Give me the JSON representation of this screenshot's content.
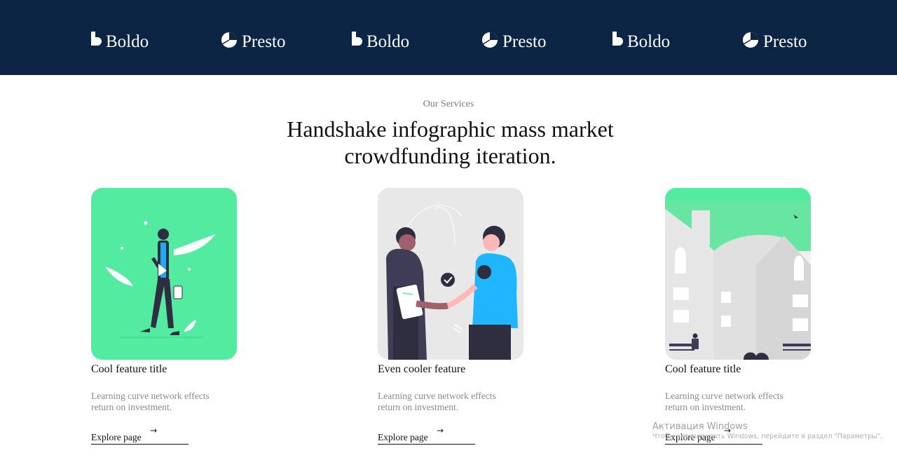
{
  "header": {
    "background": "#0c2544",
    "logos": [
      {
        "name": "Boldo",
        "icon": "boldo-b-icon"
      },
      {
        "name": "Presto",
        "icon": "presto-pie-icon"
      },
      {
        "name": "Boldo",
        "icon": "boldo-b-icon"
      },
      {
        "name": "Presto",
        "icon": "presto-pie-icon"
      },
      {
        "name": "Boldo",
        "icon": "boldo-b-icon"
      },
      {
        "name": "Presto",
        "icon": "presto-pie-icon"
      }
    ]
  },
  "services": {
    "eyebrow": "Our Services",
    "heading_line1": "Handshake infographic mass market",
    "heading_line2": "crowdfunding iteration.",
    "cards": [
      {
        "title": "Cool feature title",
        "description_line1": "Learning curve network effects",
        "description_line2": "return on investment.",
        "cta": "Explore page",
        "illustration": "person-walking-illustration",
        "accent": "#52eba0"
      },
      {
        "title": "Even cooler feature",
        "description_line1": "Learning curve network effects",
        "description_line2": "return on investment.",
        "cta": "Explore page",
        "illustration": "handshake-illustration",
        "accent": "#e8e8e8"
      },
      {
        "title": "Cool feature title",
        "description_line1": "Learning curve network effects",
        "description_line2": "return on investment.",
        "cta": "Explore page",
        "illustration": "city-bench-illustration",
        "accent": "#66e6a0"
      }
    ]
  },
  "os_watermark": {
    "title": "Активация Windows",
    "subtitle": "Чтобы активировать Windows, перейдите в раздел \"Параметры\"."
  }
}
